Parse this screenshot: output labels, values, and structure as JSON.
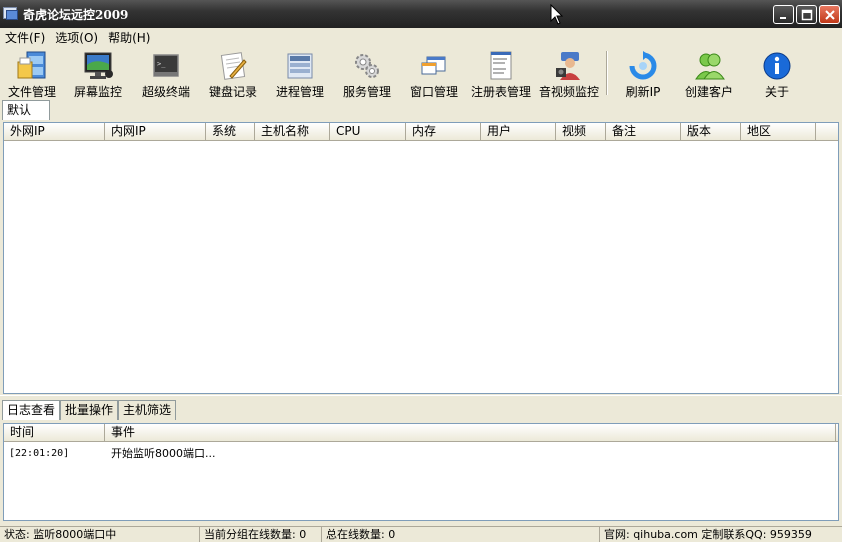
{
  "window": {
    "title": "奇虎论坛远控2009"
  },
  "menu": [
    {
      "label": "文件(F)"
    },
    {
      "label": "选项(O)"
    },
    {
      "label": "帮助(H)"
    }
  ],
  "toolbar": [
    {
      "label": "文件管理",
      "icon": "file-cabinet-icon"
    },
    {
      "label": "屏幕监控",
      "icon": "monitor-icon"
    },
    {
      "label": "超级终端",
      "icon": "terminal-icon"
    },
    {
      "label": "键盘记录",
      "icon": "notepad-pen-icon"
    },
    {
      "label": "进程管理",
      "icon": "process-list-icon"
    },
    {
      "label": "服务管理",
      "icon": "gears-icon"
    },
    {
      "label": "窗口管理",
      "icon": "windows-icon"
    },
    {
      "label": "注册表管理",
      "icon": "registry-icon"
    },
    {
      "label": "音视频监控",
      "icon": "webcam-person-icon"
    },
    {
      "label": "刷新IP",
      "icon": "refresh-icon"
    },
    {
      "label": "创建客户",
      "icon": "users-icon"
    },
    {
      "label": "关于",
      "icon": "info-icon"
    }
  ],
  "group_tab": {
    "label": "默认"
  },
  "table": {
    "columns": [
      "外网IP",
      "内网IP",
      "系统",
      "主机名称",
      "CPU",
      "内存",
      "用户",
      "视频",
      "备注",
      "版本",
      "地区"
    ],
    "rows": []
  },
  "bottom_tabs": [
    {
      "label": "日志查看",
      "active": true
    },
    {
      "label": "批量操作",
      "active": false
    },
    {
      "label": "主机筛选",
      "active": false
    }
  ],
  "log": {
    "columns": [
      "时间",
      "事件"
    ],
    "rows": [
      {
        "time": "[22:01:20]",
        "event": "开始监听8000端口..."
      }
    ]
  },
  "status": {
    "state": "状态: 监听8000端口中",
    "group_online": "当前分组在线数量: 0",
    "total_online": "总在线数量: 0",
    "contact": "官网: qihuba.com 定制联系QQ: 959359"
  }
}
